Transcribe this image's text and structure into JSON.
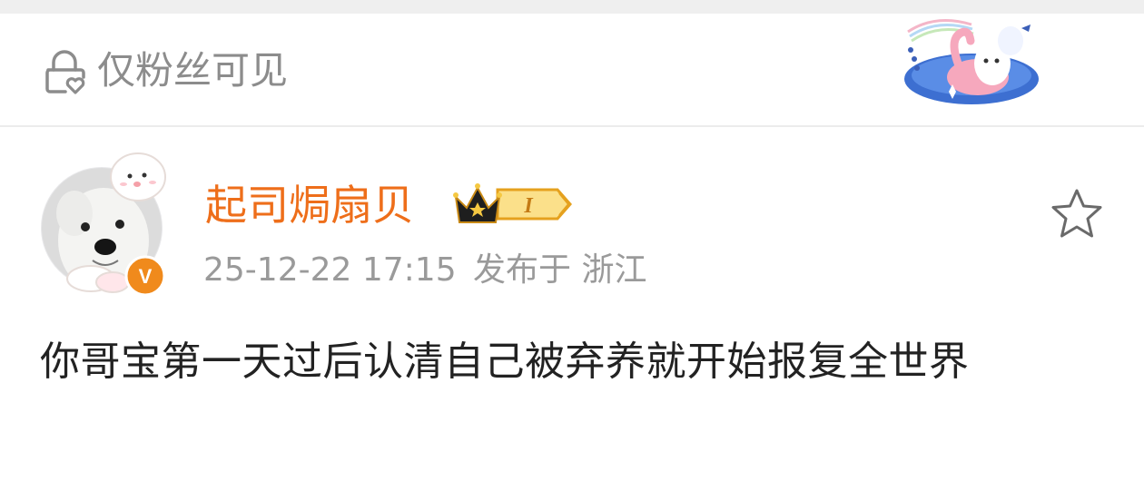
{
  "visibility": {
    "label": "仅粉丝可见",
    "icon": "lock-heart-icon",
    "decoration": "cartoon-ghost-swan-float-sticker"
  },
  "post": {
    "author": {
      "name": "起司焗扇贝",
      "avatar": "puppy-avatar",
      "verified_badge": "V",
      "fan_level": "I"
    },
    "time": "25-12-22 17:15",
    "location": "发布于 浙江",
    "text": "你哥宝第一天过后认清自己被弃养就开始报复全世界",
    "favorite_icon": "star-outline-icon"
  },
  "colors": {
    "name_orange": "#ee6e1a",
    "meta_gray": "#9a9a9a",
    "text_dark": "#222222",
    "badge_orange": "#f08a1c",
    "crown_gold": "#f5c842"
  }
}
